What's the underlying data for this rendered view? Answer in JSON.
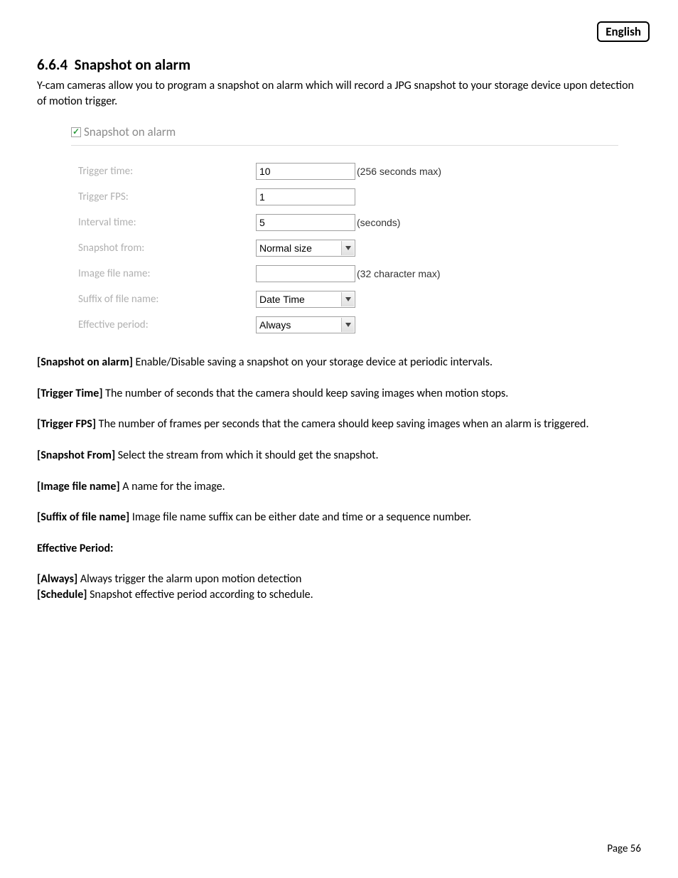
{
  "language_badge": "English",
  "section_number": "6.6.4",
  "section_title": "Snapshot on alarm",
  "intro": "Y-cam cameras allow you to program a snapshot on alarm which will record a JPG snapshot to your storage device upon detection of motion trigger.",
  "panel": {
    "checkbox_checked": true,
    "title": "Snapshot on alarm",
    "rows": {
      "trigger_time": {
        "label": "Trigger time:",
        "value": "10",
        "suffix": "(256 seconds max)"
      },
      "trigger_fps": {
        "label": "Trigger FPS:",
        "value": "1",
        "suffix": ""
      },
      "interval_time": {
        "label": "Interval time:",
        "value": "5",
        "suffix": "(seconds)"
      },
      "snapshot_from": {
        "label": "Snapshot from:",
        "value": "Normal size"
      },
      "image_file": {
        "label": "Image file name:",
        "value": "",
        "suffix": "(32 character max)"
      },
      "suffix_file": {
        "label": "Suffix of file name:",
        "value": "Date Time"
      },
      "effective": {
        "label": "Effective period:",
        "value": "Always"
      }
    }
  },
  "definitions": [
    {
      "term": "[Snapshot on alarm]",
      "text": " Enable/Disable saving a snapshot on your storage device at periodic intervals."
    },
    {
      "term": " [Trigger Time]",
      "text": " The number of seconds that the camera should keep saving images when motion stops."
    },
    {
      "term": "[Trigger FPS]",
      "text": " The number of frames per seconds that the camera should keep saving images when an alarm is triggered."
    },
    {
      "term": "[Snapshot From]",
      "text": " Select the stream from which it should get the snapshot."
    },
    {
      "term": "[Image file name]",
      "text": " A name for the image."
    },
    {
      "term": "[Suffix of file name]",
      "text": " Image file name suffix can be either date and time or a sequence number."
    }
  ],
  "effective_heading": "Effective Period:",
  "effective_lines": [
    {
      "term": "[Always]",
      "text": " Always trigger the alarm upon motion detection"
    },
    {
      "term": "[Schedule]",
      "text": " Snapshot effective period according to schedule."
    }
  ],
  "page_label": "Page 56"
}
